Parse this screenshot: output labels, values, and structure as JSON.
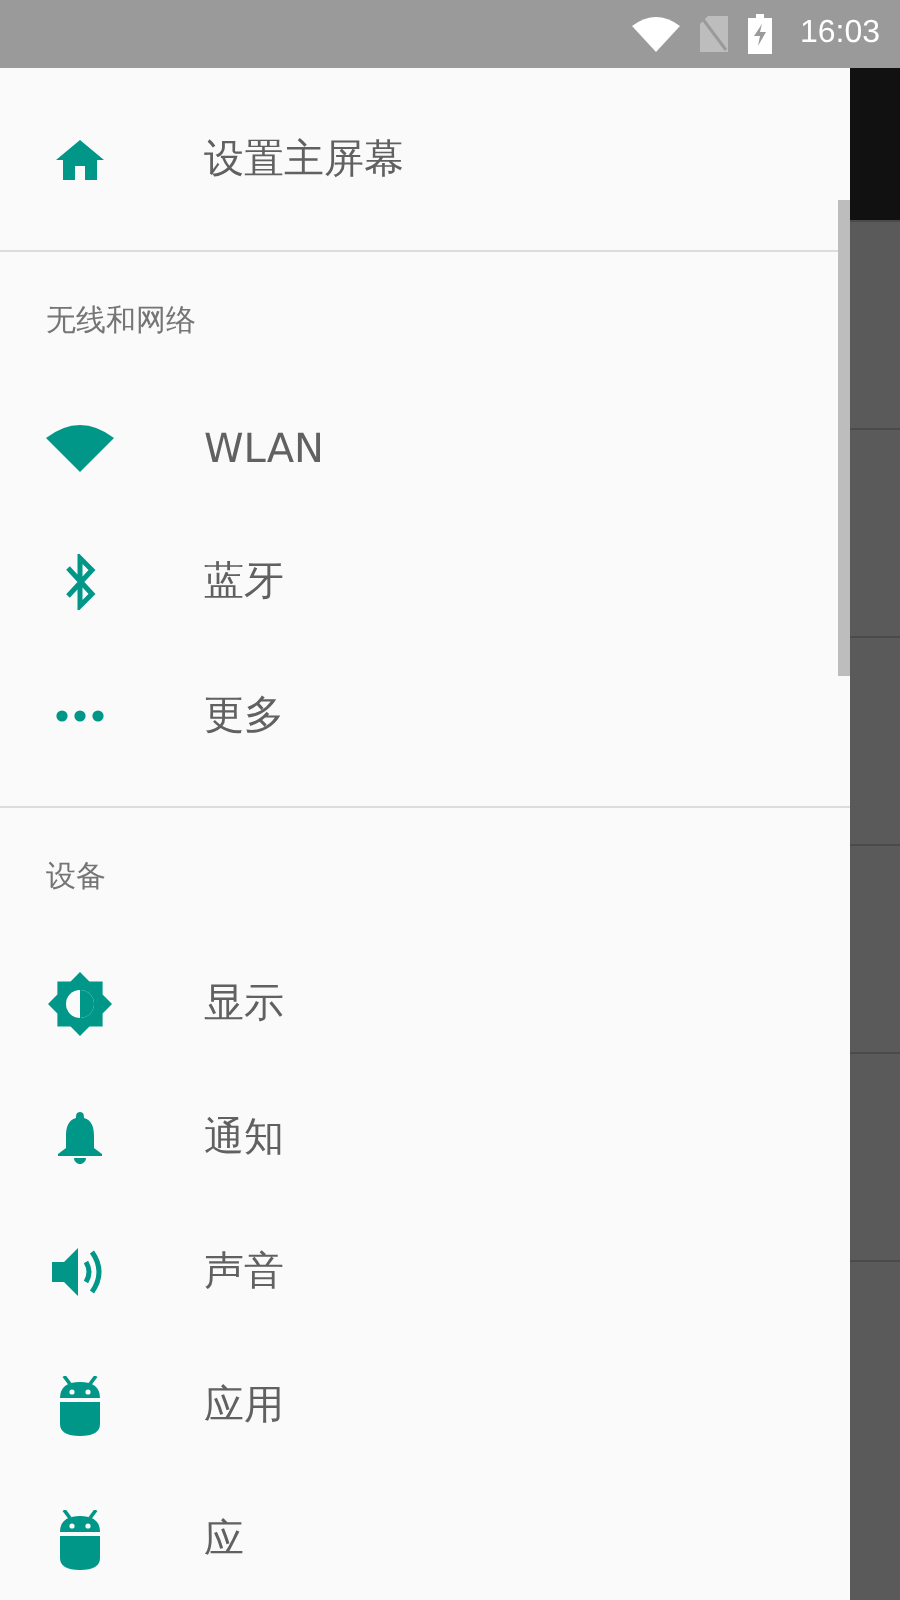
{
  "status_bar": {
    "time": "16:03"
  },
  "drawer": {
    "sections": [
      {
        "items": [
          {
            "kind": "home",
            "label": "设置主屏幕"
          }
        ]
      },
      {
        "header": "无线和网络",
        "items": [
          {
            "kind": "wifi",
            "label": "WLAN"
          },
          {
            "kind": "bluetooth",
            "label": "蓝牙"
          },
          {
            "kind": "more",
            "label": "更多"
          }
        ]
      },
      {
        "header": "设备",
        "items": [
          {
            "kind": "display",
            "label": "显示"
          },
          {
            "kind": "bell",
            "label": "通知"
          },
          {
            "kind": "sound",
            "label": "声音"
          },
          {
            "kind": "android",
            "label": "应用"
          },
          {
            "kind": "android",
            "label": "应"
          }
        ]
      }
    ]
  }
}
